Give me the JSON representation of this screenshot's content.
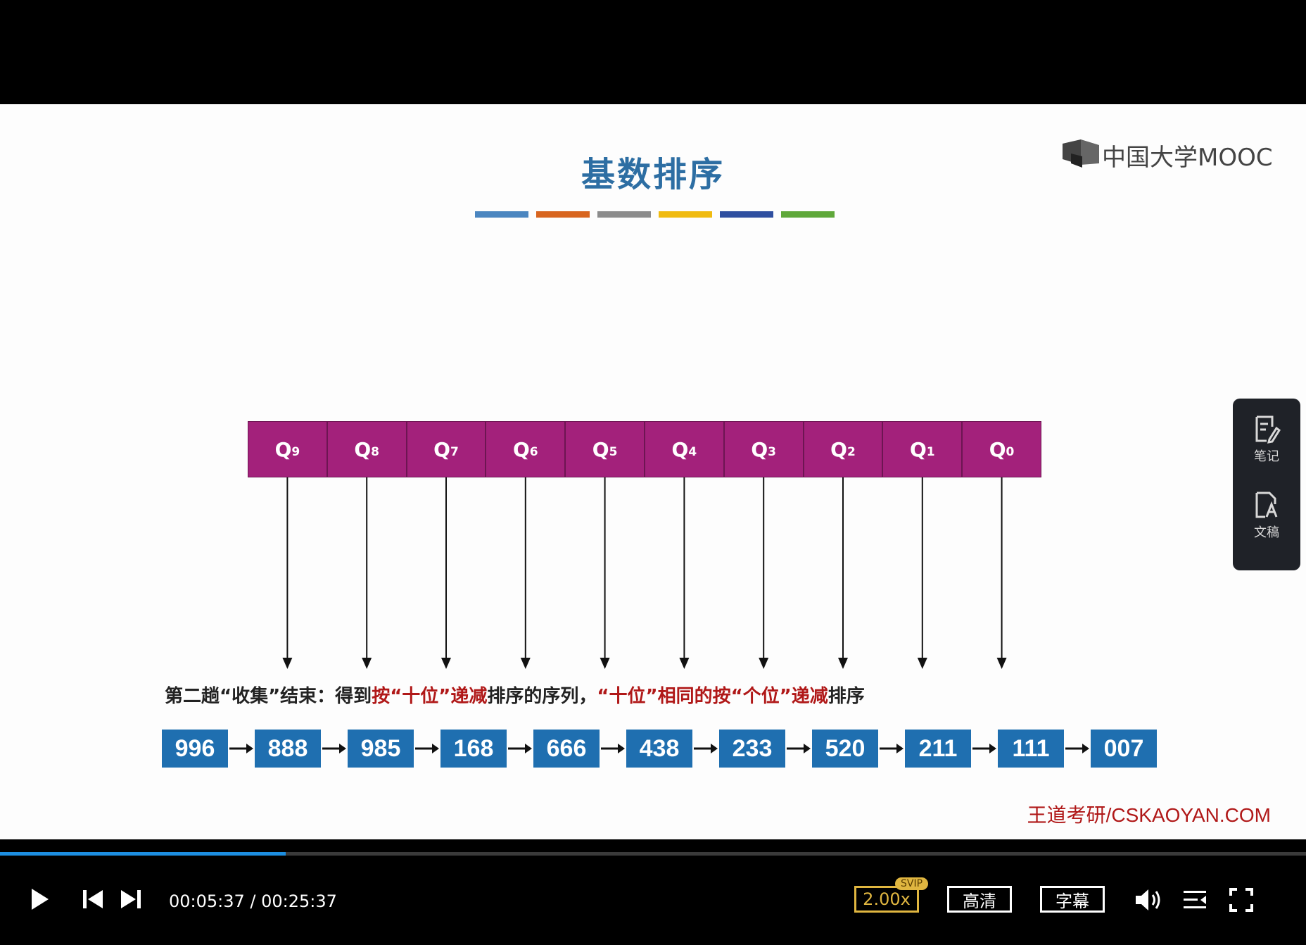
{
  "slide": {
    "title": "基数排序",
    "color_bar": [
      "#4b86c0",
      "#d8651f",
      "#8c8c8c",
      "#f0bb10",
      "#2f4fa0",
      "#5fa83a"
    ],
    "logo_text": "中国大学MOOC",
    "queues": [
      {
        "label": "Q",
        "sub": "9"
      },
      {
        "label": "Q",
        "sub": "8"
      },
      {
        "label": "Q",
        "sub": "7"
      },
      {
        "label": "Q",
        "sub": "6"
      },
      {
        "label": "Q",
        "sub": "5"
      },
      {
        "label": "Q",
        "sub": "4"
      },
      {
        "label": "Q",
        "sub": "3"
      },
      {
        "label": "Q",
        "sub": "2"
      },
      {
        "label": "Q",
        "sub": "1"
      },
      {
        "label": "Q",
        "sub": "0"
      }
    ],
    "caption": {
      "part1": "第二趟“收集”结束：得到",
      "part2": "按“十位”递减",
      "part3": "排序的序列，",
      "part4": "“十位”相同的按“个位”递减",
      "part5": "排序"
    },
    "sequence": [
      "996",
      "888",
      "985",
      "168",
      "666",
      "438",
      "233",
      "520",
      "211",
      "111",
      "007"
    ],
    "watermark": "王道考研/CSKAOYAN.COM",
    "colors": {
      "queue": "#a3217b",
      "number_box": "#1f6fb0",
      "highlight": "#b01818",
      "title": "#2d6ea3"
    }
  },
  "side_panel": {
    "notes_label": "笔记",
    "transcript_label": "文稿"
  },
  "player": {
    "current_time": "00:05:37",
    "total_time": "00:25:37",
    "progress": 0.219,
    "speed_label": "2.00x",
    "svip_badge": "SVIP",
    "quality_label": "高清",
    "subtitle_label": "字幕"
  }
}
